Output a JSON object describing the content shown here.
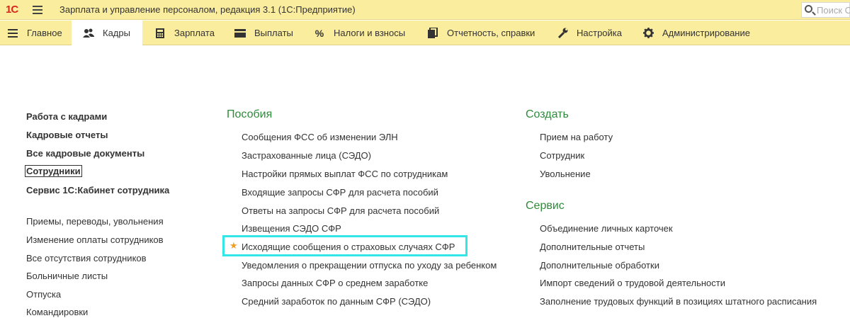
{
  "titlebar": {
    "logo": "1С",
    "title": "Зарплата и управление персоналом, редакция 3.1  (1С:Предприятие)",
    "search_placeholder": "Поиск С"
  },
  "menu": {
    "tabs": [
      {
        "label": "Главное",
        "icon": "hamburger-icon",
        "active": false
      },
      {
        "label": "Кадры",
        "icon": "people-icon",
        "active": true
      },
      {
        "label": "Зарплата",
        "icon": "calculator-icon",
        "active": false
      },
      {
        "label": "Выплаты",
        "icon": "card-icon",
        "active": false
      },
      {
        "label": "Налоги и взносы",
        "icon": "percent-icon",
        "active": false
      },
      {
        "label": "Отчетность, справки",
        "icon": "reports-icon",
        "active": false
      },
      {
        "label": "Настройка",
        "icon": "wrench-icon",
        "active": false
      },
      {
        "label": "Администрирование",
        "icon": "gear-icon",
        "active": false
      }
    ]
  },
  "left": {
    "bold_links": [
      "Работа с кадрами",
      "Кадровые отчеты",
      "Все кадровые документы",
      "Сотрудники",
      "Сервис 1С:Кабинет сотрудника"
    ],
    "links": [
      "Приемы, переводы, увольнения",
      "Изменение оплаты сотрудников",
      "Все отсутствия сотрудников",
      "Больничные листы",
      "Отпуска",
      "Командировки"
    ]
  },
  "middle": {
    "title": "Пособия",
    "links": [
      "Сообщения ФСС об изменении ЭЛН",
      "Застрахованные лица (СЭДО)",
      "Настройки прямых выплат ФСС по сотрудникам",
      "Входящие запросы СФР для расчета пособий",
      "Ответы на запросы СФР для расчета пособий",
      "Извещения СЭДО СФР",
      "Исходящие сообщения о страховых случаях СФР",
      "Уведомления о прекращении отпуска по уходу за ребенком",
      "Запросы данных СФР о среднем заработке",
      "Средний заработок по данным СФР (СЭДО)"
    ]
  },
  "right": {
    "create_title": "Создать",
    "create_links": [
      "Прием на работу",
      "Сотрудник",
      "Увольнение"
    ],
    "service_title": "Сервис",
    "service_links": [
      "Объединение личных карточек",
      "Дополнительные отчеты",
      "Дополнительные обработки",
      "Импорт сведений о трудовой деятельности",
      "Заполнение трудовых функций в позициях штатного расписания"
    ]
  },
  "colors": {
    "panel": "#fbed9e",
    "section": "#2e8b3a",
    "highlight": "#35e6e8",
    "star": "#f0a020"
  }
}
